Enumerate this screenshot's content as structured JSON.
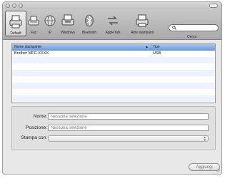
{
  "toolbar": {
    "items": [
      {
        "label": "Default",
        "icon": "printer-icon",
        "selected": true
      },
      {
        "label": "Fax",
        "icon": "fax-icon"
      },
      {
        "label": "IP",
        "icon": "globe-icon"
      },
      {
        "label": "Windows",
        "icon": "windows-printer-icon"
      },
      {
        "label": "Bluetooth",
        "icon": "bluetooth-icon"
      },
      {
        "label": "AppleTalk",
        "icon": "appletalk-icon"
      },
      {
        "label": "Altre stampanti",
        "icon": "other-printers-icon"
      }
    ],
    "search": {
      "label": "Cerca",
      "value": ""
    }
  },
  "list": {
    "columns": {
      "name": "Nome stampante",
      "type": "Tipo"
    },
    "rows": [
      {
        "name": "Brother MFC-XXXX",
        "type": "USB"
      }
    ],
    "sort_indicator": "▲"
  },
  "form": {
    "name_label": "Nome:",
    "name_value": "Nessuna selezione",
    "location_label": "Posizione:",
    "location_value": "Nessuna selezione",
    "print_with_label": "Stampa con:",
    "print_with_value": ""
  },
  "buttons": {
    "add": "Aggiungi"
  },
  "colors": {
    "selection_header": "#7fa8e2",
    "row_alt": "#edf3fe"
  }
}
